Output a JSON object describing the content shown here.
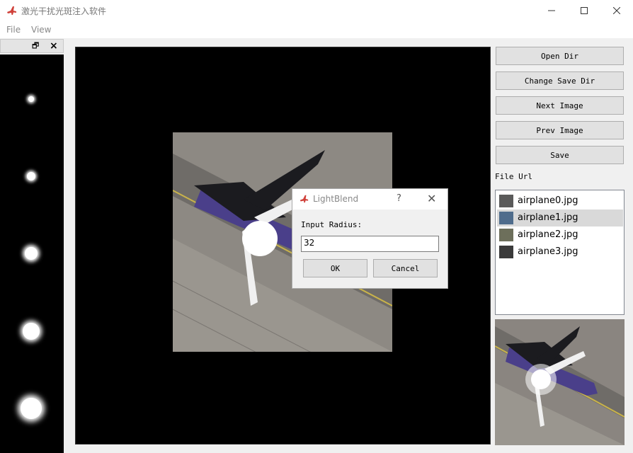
{
  "window": {
    "title": "激光干扰光斑注入软件",
    "minimize_icon": "minimize-icon",
    "maximize_icon": "maximize-icon",
    "close_icon": "close-icon"
  },
  "menu": {
    "items": [
      "File",
      "View"
    ]
  },
  "buttons": {
    "open_dir": "Open Dir",
    "change_save_dir": "Change Save Dir",
    "next_image": "Next Image",
    "prev_image": "Prev Image",
    "save": "Save"
  },
  "file_panel": {
    "label": "File Url",
    "files": [
      "airplane0.jpg",
      "airplane1.jpg",
      "airplane2.jpg",
      "airplane3.jpg"
    ],
    "selected_index": 1
  },
  "dialog": {
    "title": "LightBlend",
    "help": "?",
    "label": "Input Radius:",
    "value": "32",
    "ok": "OK",
    "cancel": "Cancel"
  },
  "colors": {
    "accent": "#d0413a",
    "canvas_bg": "#000000",
    "selection": "#d9d9d9"
  }
}
